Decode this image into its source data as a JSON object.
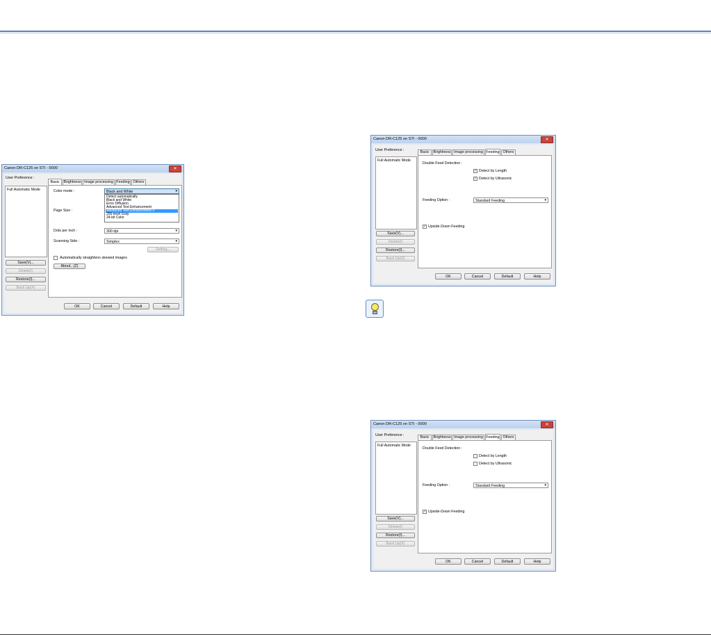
{
  "dialog": {
    "title": "Canon DR-C125 on STI - 0000",
    "close_glyph": "✕",
    "user_preference_label": "User Preference :",
    "preference_item": "Full Automatic Mode",
    "save_label": "Save(V)...",
    "delete_label": "Delete(I)",
    "restore_label": "Restore(I)...",
    "backup_label": "Back Up(X)",
    "ok_label": "OK",
    "cancel_label": "Cancel",
    "default_label": "Default",
    "help_label": "Help",
    "tabs": [
      "Basic",
      "Brightness",
      "Image processing",
      "Feeding",
      "Others"
    ]
  },
  "basic": {
    "color_mode_label": "Color mode :",
    "color_mode_value": "Black and White",
    "color_mode_options": [
      "Detect automatically",
      "Black and White",
      "Error Diffusion",
      "Advanced Text Enhancement",
      "Advanced Text Enhancement II",
      "256-level Gray",
      "24-bit Color"
    ],
    "selected_option": "Advanced Text Enhancement II",
    "page_size_label": "Page Size :",
    "dpi_label": "Dots per inch :",
    "dpi_value": "300 dpi",
    "scanning_side_label": "Scanning Side :",
    "scanning_side_value": "Simplex",
    "setting_label": "Setting...",
    "straighten_label": "Automatically straightens skewed images",
    "about_label": "About...(Z)"
  },
  "feeding_checked": {
    "double_feed_label": "Double Feed Detection :",
    "detect_length_label": "Detect by Length",
    "detect_ultrasonic_label": "Detect by Ultrasonic",
    "detect_length_checked": true,
    "detect_ultrasonic_checked": true,
    "feeding_option_label": "Feeding Option :",
    "feeding_option_value": "Standard Feeding",
    "upside_down_label": "Upside-Down Feeding",
    "upside_down_checked": true
  },
  "feeding_unchecked": {
    "double_feed_label": "Double Feed Detection :",
    "detect_length_label": "Detect by Length",
    "detect_ultrasonic_label": "Detect by Ultrasonic",
    "detect_length_checked": false,
    "detect_ultrasonic_checked": false,
    "feeding_option_label": "Feeding Option :",
    "feeding_option_value": "Standard Feeding",
    "upside_down_label": "Upside-Down Feeding",
    "upside_down_checked": true
  },
  "icons": {
    "check": "✓",
    "dropdown_arrow": "▾",
    "hint": "lightbulb-icon"
  },
  "colors": {
    "rule": "#5b7fb5",
    "selection": "#3399ff",
    "close": "#c9443a"
  }
}
